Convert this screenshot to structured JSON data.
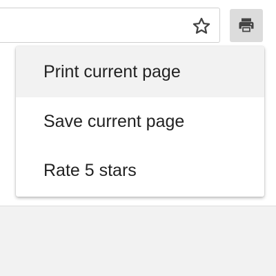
{
  "toolbar": {
    "bookmark_icon": "star-outline-icon",
    "print_icon": "printer-icon"
  },
  "menu": {
    "items": [
      {
        "label": "Print current page",
        "highlighted": true
      },
      {
        "label": "Save current page",
        "highlighted": false
      },
      {
        "label": "Rate 5 stars",
        "highlighted": false
      }
    ]
  },
  "colors": {
    "icon": "#444444",
    "print_button_bg": "#dcdcdc",
    "menu_highlight": "#f2f2f2",
    "menu_text": "#222222"
  }
}
